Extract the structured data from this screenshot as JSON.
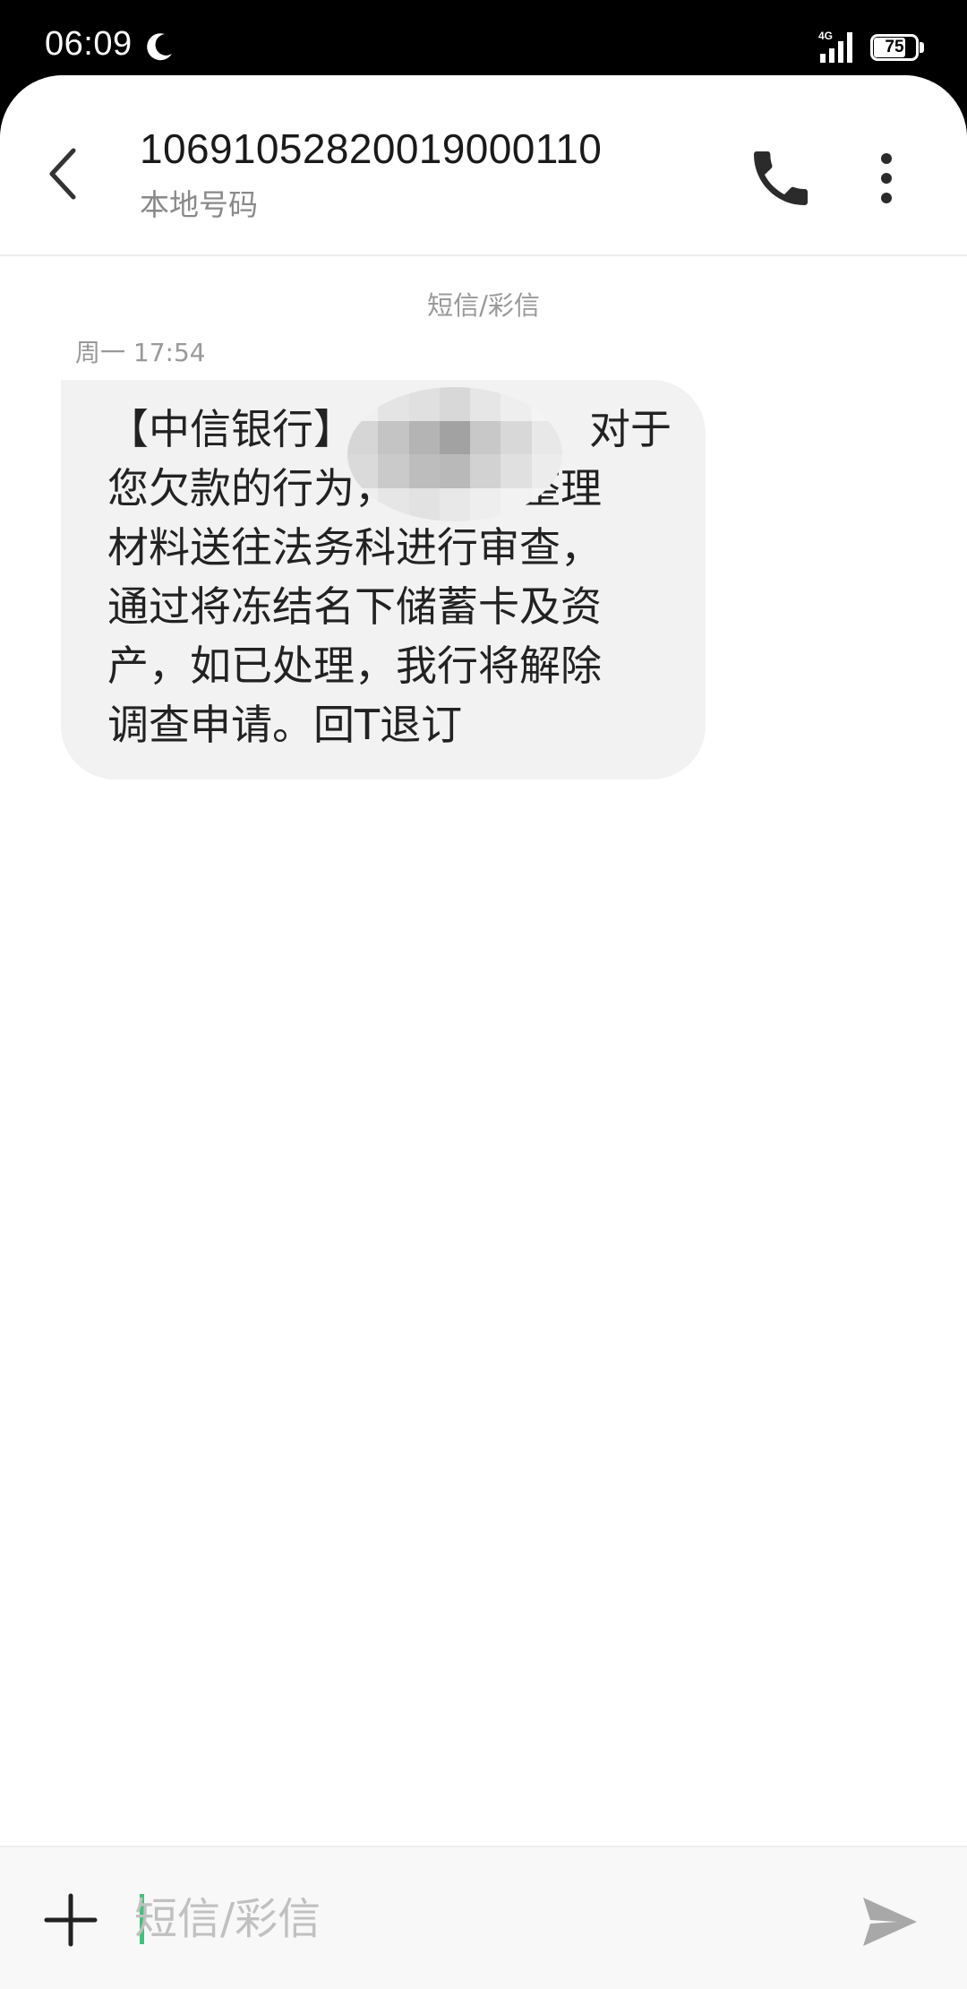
{
  "status_bar": {
    "time": "06:09",
    "network": "4G",
    "battery": "75",
    "battery_level": 0.75
  },
  "header": {
    "contact_number": "10691052820019000110",
    "contact_subtitle": "本地号码",
    "back_icon": "chevron-left-icon",
    "call_icon": "phone-icon",
    "more_icon": "more-vertical-icon"
  },
  "conversation": {
    "channel_label": "短信/彩信",
    "messages": [
      {
        "time": "周一 17:54",
        "lines": [
          "【中信银行】",
          "您欠款的行为，我行将整理",
          "材料送往法务科进行审查，",
          "通过将冻结名下储蓄卡及资",
          "产，如已处理，我行将解除",
          "调查申请。回T退订"
        ],
        "line1_tail": "对于"
      }
    ]
  },
  "composer": {
    "placeholder": "短信/彩信",
    "attach_icon": "plus-icon",
    "send_icon": "send-icon"
  },
  "colors": {
    "accent": "#43c17b",
    "bubble": "#f2f2f2",
    "muted": "#999999"
  }
}
